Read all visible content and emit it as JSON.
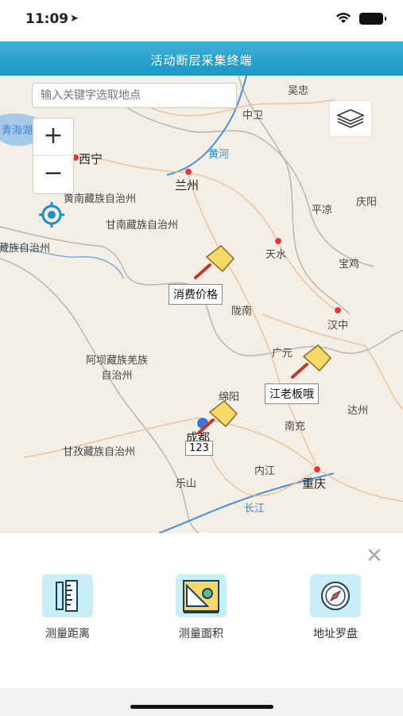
{
  "status_bar": {
    "time": "11:09"
  },
  "header": {
    "title": "活动断层采集终端"
  },
  "search": {
    "placeholder": "输入关键字选取地点"
  },
  "zoom": {
    "in_label": "+",
    "out_label": "−"
  },
  "map_labels": {
    "cities": [
      "西宁",
      "兰州",
      "成都",
      "重庆"
    ],
    "places": [
      "吴忠",
      "中卫",
      "青海湖",
      "黄南藏族自治州",
      "甘南藏族自治州",
      "藏族自治州",
      "平凉",
      "庆阳",
      "天水",
      "宝鸡",
      "陇南",
      "汉中",
      "广元",
      "绵阳",
      "达州",
      "南充",
      "阿坝藏族羌族自治州",
      "甘孜藏族自治州",
      "内江",
      "乐山"
    ],
    "rivers": [
      "黄河",
      "长江"
    ]
  },
  "markers": [
    {
      "label": "消费价格"
    },
    {
      "label": "江老板哦"
    },
    {
      "label": "123"
    }
  ],
  "tools": [
    {
      "label": "测量距离",
      "icon": "ruler-icon"
    },
    {
      "label": "测量面积",
      "icon": "area-measure-icon"
    },
    {
      "label": "地址罗盘",
      "icon": "compass-icon"
    }
  ],
  "colors": {
    "header": "#1a97c4",
    "tool_bg": "#c8eef6",
    "pin": "#f6d86b"
  }
}
